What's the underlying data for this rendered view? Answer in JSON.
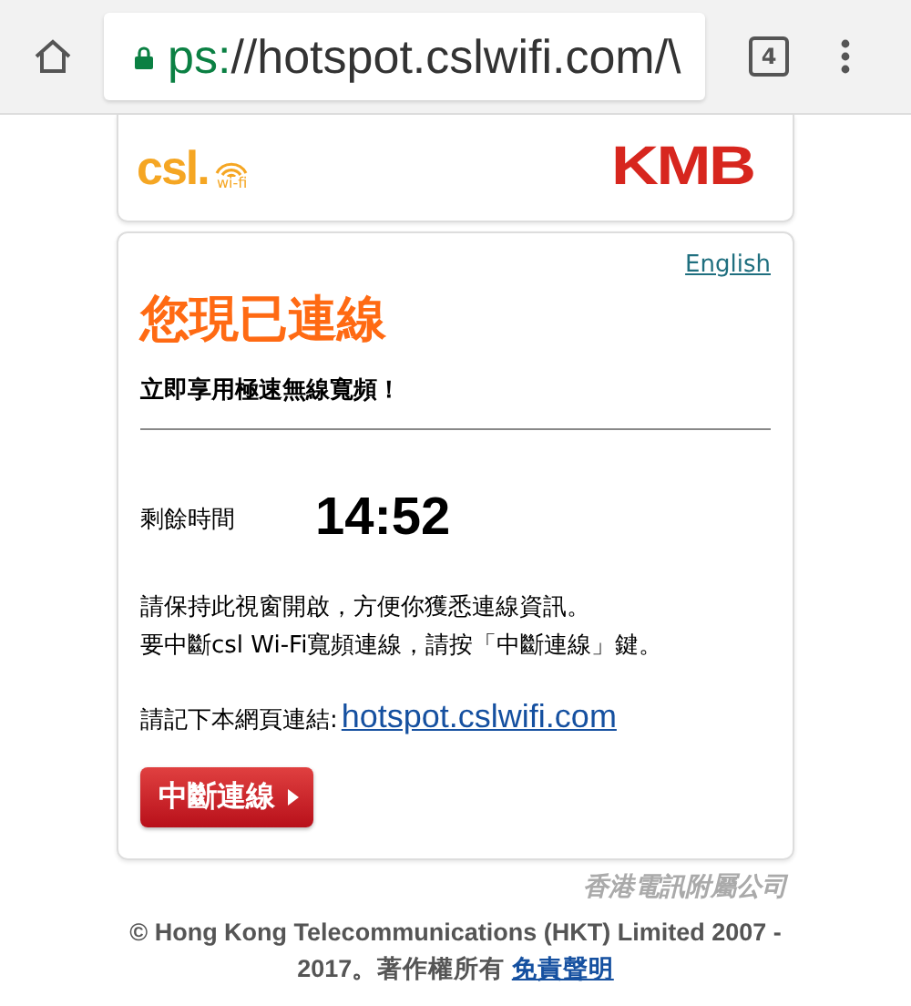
{
  "browser": {
    "url_scheme": "ps:",
    "url_rest": "//hotspot.cslwifi.com/\\",
    "tab_count": "4"
  },
  "header": {
    "left_logo": "csl.",
    "left_logo_sub": "wi-fi",
    "right_logo": "KMB"
  },
  "card": {
    "language_link": "English",
    "title": "您現已連線",
    "subtitle": "立即享用極速無線寬頻！",
    "timer_label": "剩餘時間",
    "timer": "14:52",
    "notes": [
      "請保持此視窗開啟，方便你獲悉連線資訊。",
      "要中斷csl Wi-Fi寬頻連線，請按「中斷連線」鍵。"
    ],
    "bookmark_label": "請記下本網頁連結:",
    "bookmark_link": "hotspot.cslwifi.com",
    "disconnect_button": "中斷連線"
  },
  "footer": {
    "company": "香港電訊附屬公司",
    "copyright": "© Hong Kong Telecommunications (HKT) Limited 2007 - 2017。著作權所有",
    "disclaimer_link": "免責聲明"
  }
}
